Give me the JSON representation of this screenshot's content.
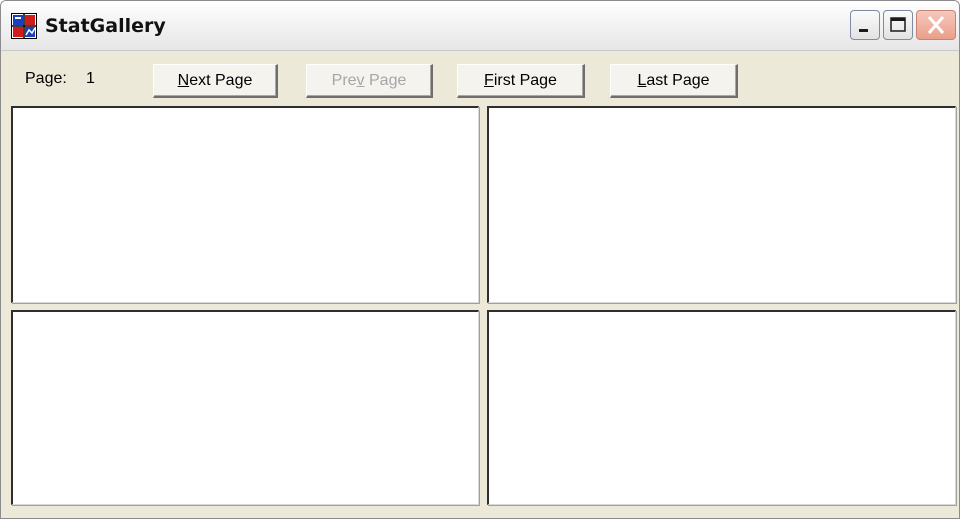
{
  "window": {
    "title": "StatGallery",
    "controls": {
      "minimize_icon": "minimize-icon",
      "maximize_icon": "maximize-icon",
      "close_icon": "close-icon"
    },
    "app_icon": "statgallery-app-icon"
  },
  "toolbar": {
    "page_label": "Page:",
    "page_number": "1",
    "next": {
      "pre": "",
      "mnemonic": "N",
      "post": "ext Page",
      "enabled": true
    },
    "prev": {
      "pre": "Pre",
      "mnemonic": "v",
      "post": " Page",
      "enabled": false
    },
    "first": {
      "pre": "",
      "mnemonic": "F",
      "post": "irst Page",
      "enabled": true
    },
    "last": {
      "pre": "",
      "mnemonic": "L",
      "post": "ast Page",
      "enabled": true
    }
  },
  "gallery": {
    "panels": [
      "",
      "",
      "",
      ""
    ]
  },
  "colors": {
    "window_bg": "#ece9d8",
    "panel_bg": "#ffffff",
    "close_button": "#e9a089",
    "disabled_text": "#a6a6a6"
  }
}
